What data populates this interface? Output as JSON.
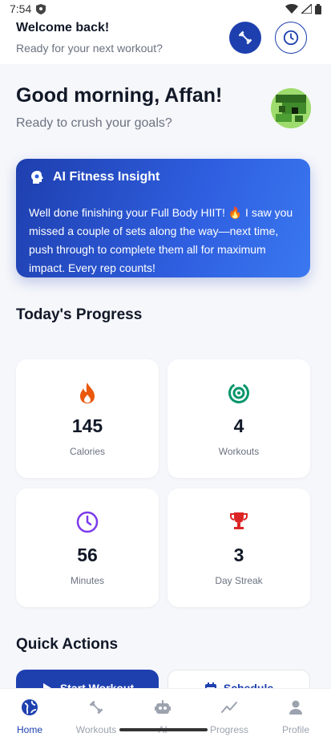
{
  "status": {
    "time": "7:54"
  },
  "header": {
    "welcome": "Welcome back!",
    "subtitle": "Ready for your next workout?"
  },
  "greeting": {
    "title": "Good morning, Affan!",
    "subtitle": "Ready to crush your goals?"
  },
  "insight": {
    "title": "AI Fitness Insight",
    "body": "Well done finishing your Full Body HIIT! 🔥 I saw you missed a couple of sets along the way—next time, push through to complete them all for maximum impact. Every rep counts!"
  },
  "progress": {
    "title": "Today's Progress",
    "stats": [
      {
        "value": "145",
        "label": "Calories",
        "icon": "flame-icon",
        "color": "#ea580c"
      },
      {
        "value": "4",
        "label": "Workouts",
        "icon": "target-icon",
        "color": "#059669"
      },
      {
        "value": "56",
        "label": "Minutes",
        "icon": "clock-icon",
        "color": "#7c3aed"
      },
      {
        "value": "3",
        "label": "Day Streak",
        "icon": "trophy-icon",
        "color": "#dc2626"
      }
    ]
  },
  "quick_actions": {
    "title": "Quick Actions",
    "start_label": "Start Workout",
    "schedule_label": "Schedule"
  },
  "nav": {
    "items": [
      {
        "label": "Home"
      },
      {
        "label": "Workouts"
      },
      {
        "label": "AI"
      },
      {
        "label": "Progress"
      },
      {
        "label": "Profile"
      }
    ]
  },
  "colors": {
    "primary": "#1e40af",
    "background": "#f6f7fb"
  }
}
